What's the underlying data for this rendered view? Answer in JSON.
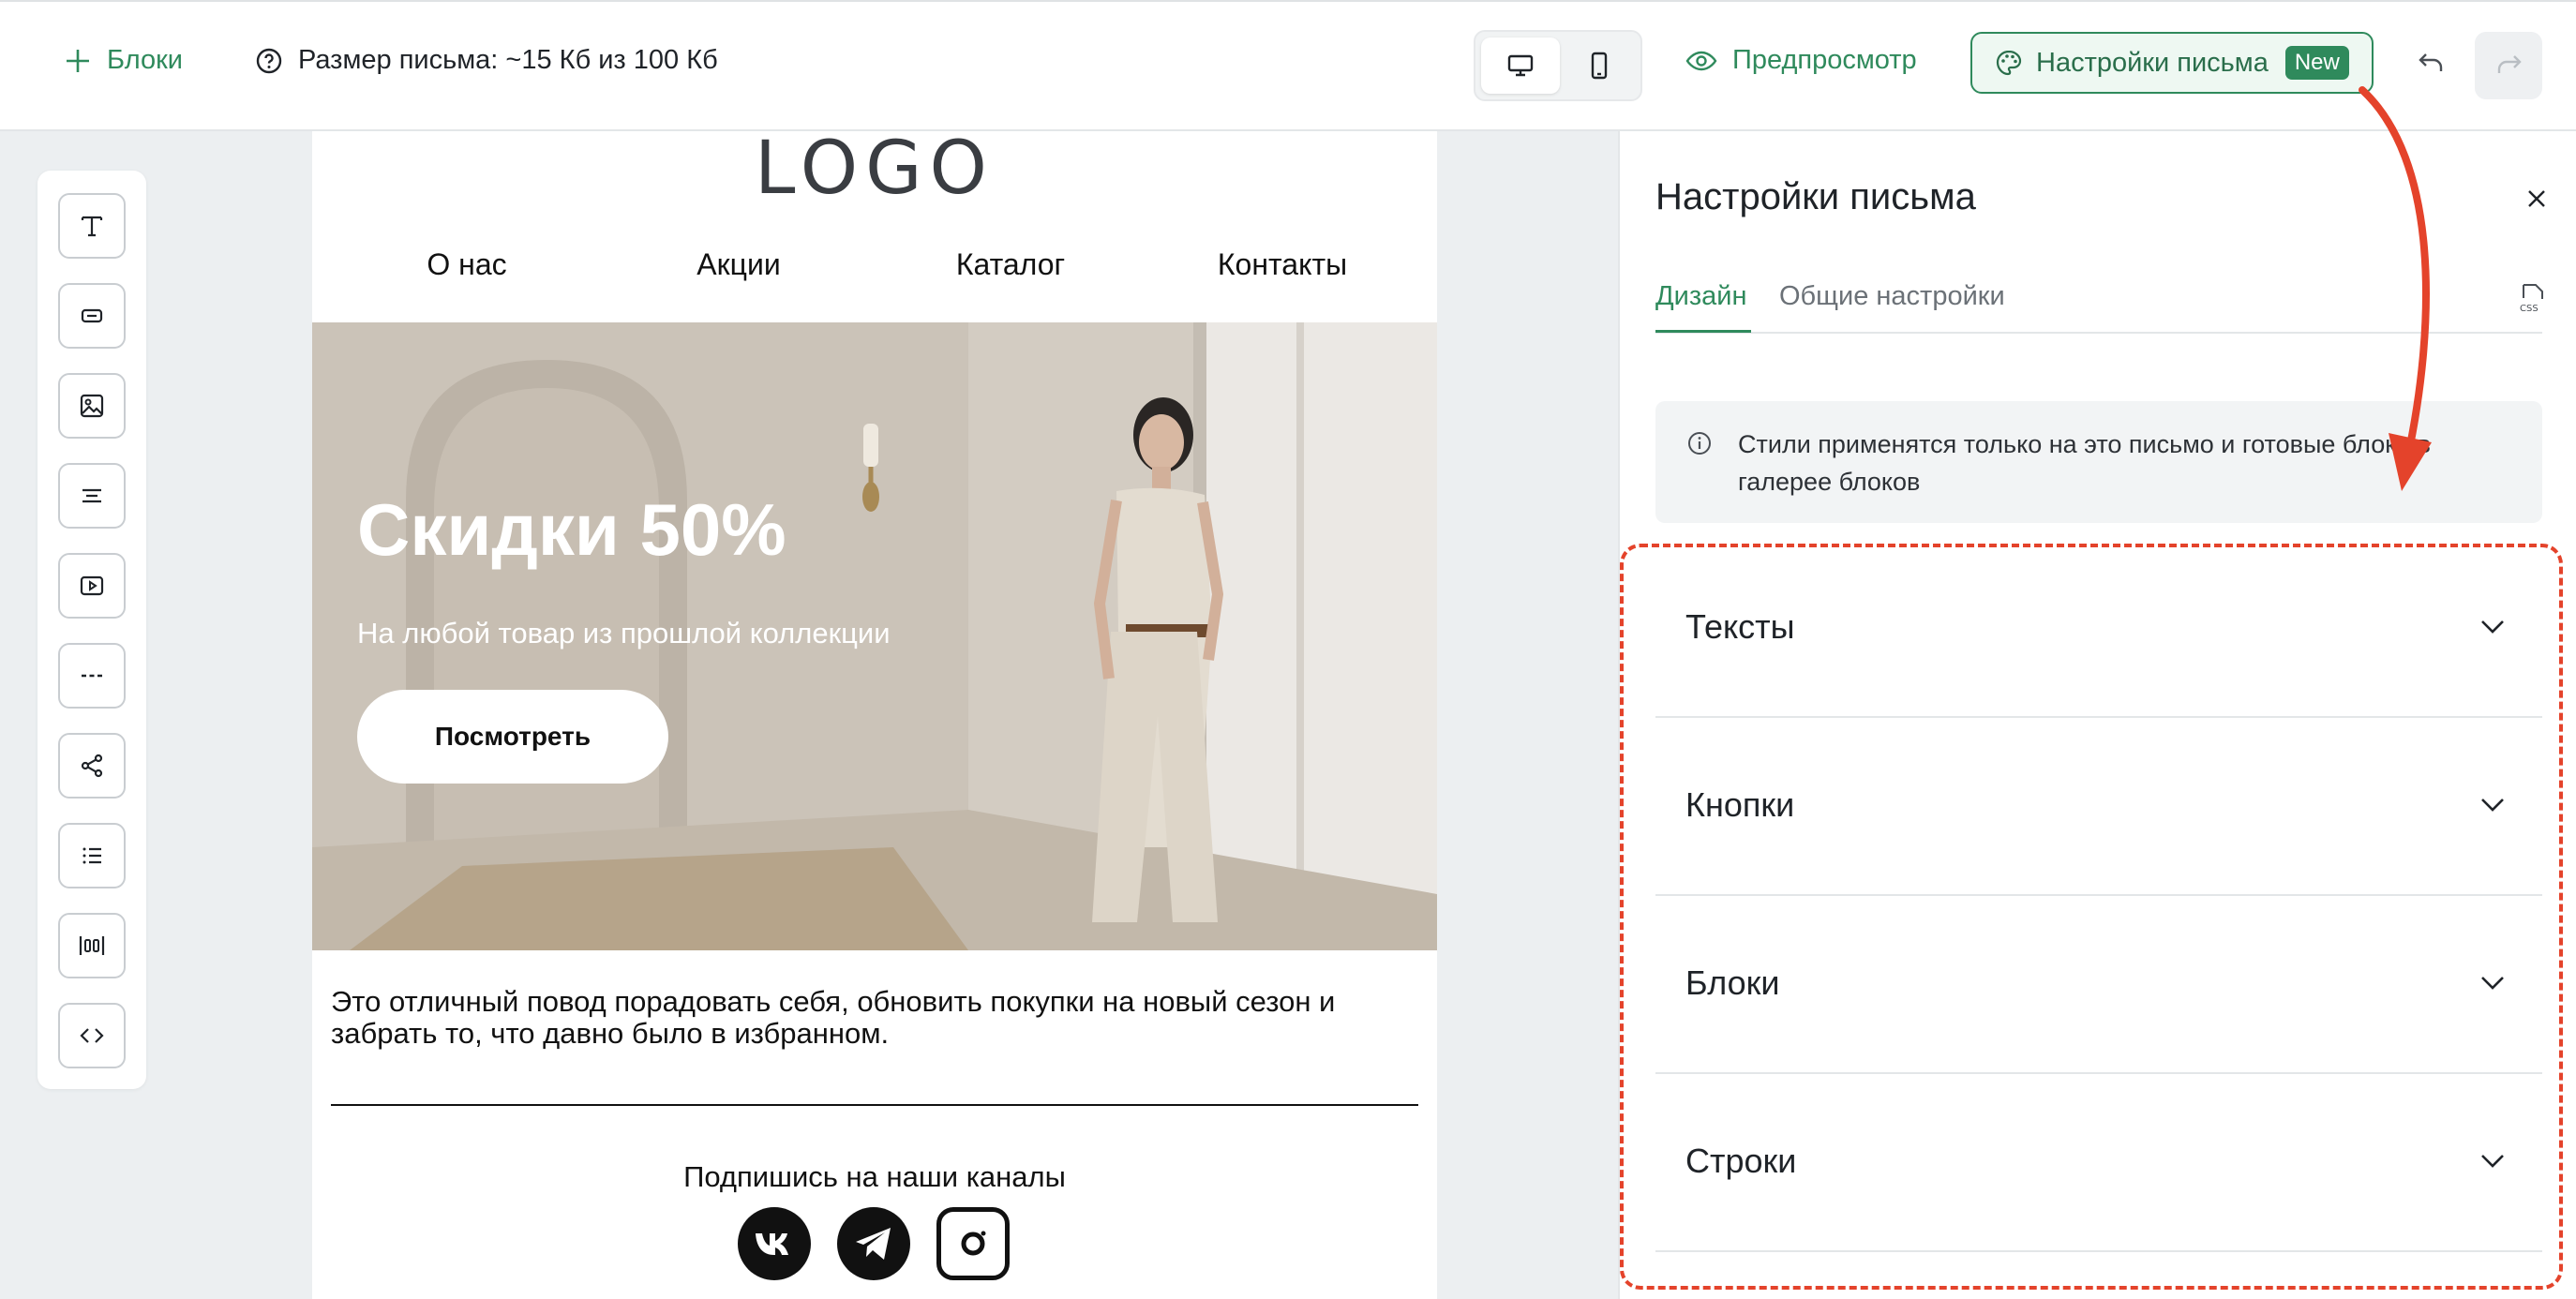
{
  "topbar": {
    "blocks_label": "Блоки",
    "size_label": "Размер письма: ~15 Кб из 100 Кб",
    "preview_label": "Предпросмотр",
    "settings_label": "Настройки письма",
    "new_badge": "New"
  },
  "email": {
    "logo": "LOGO",
    "nav": [
      "О нас",
      "Акции",
      "Каталог",
      "Контакты"
    ],
    "hero_title": "Скидки 50%",
    "hero_subtitle": "На любой товар из прошлой коллекции",
    "hero_button": "Посмотреть",
    "body_text": "Это отличный повод порадовать себя, обновить покупки на новый сезон и забрать то, что давно было в избранном.",
    "social_caption": "Подпишись на наши каналы"
  },
  "panel": {
    "title": "Настройки письма",
    "tabs": [
      "Дизайн",
      "Общие настройки"
    ],
    "css_label": "CSS",
    "info_text": "Стили применятся только на это письмо и готовые блоки в галерее блоков",
    "sections": [
      "Тексты",
      "Кнопки",
      "Блоки",
      "Строки"
    ]
  },
  "colors": {
    "accent": "#2f8a5c",
    "annotation": "#e4432b"
  }
}
